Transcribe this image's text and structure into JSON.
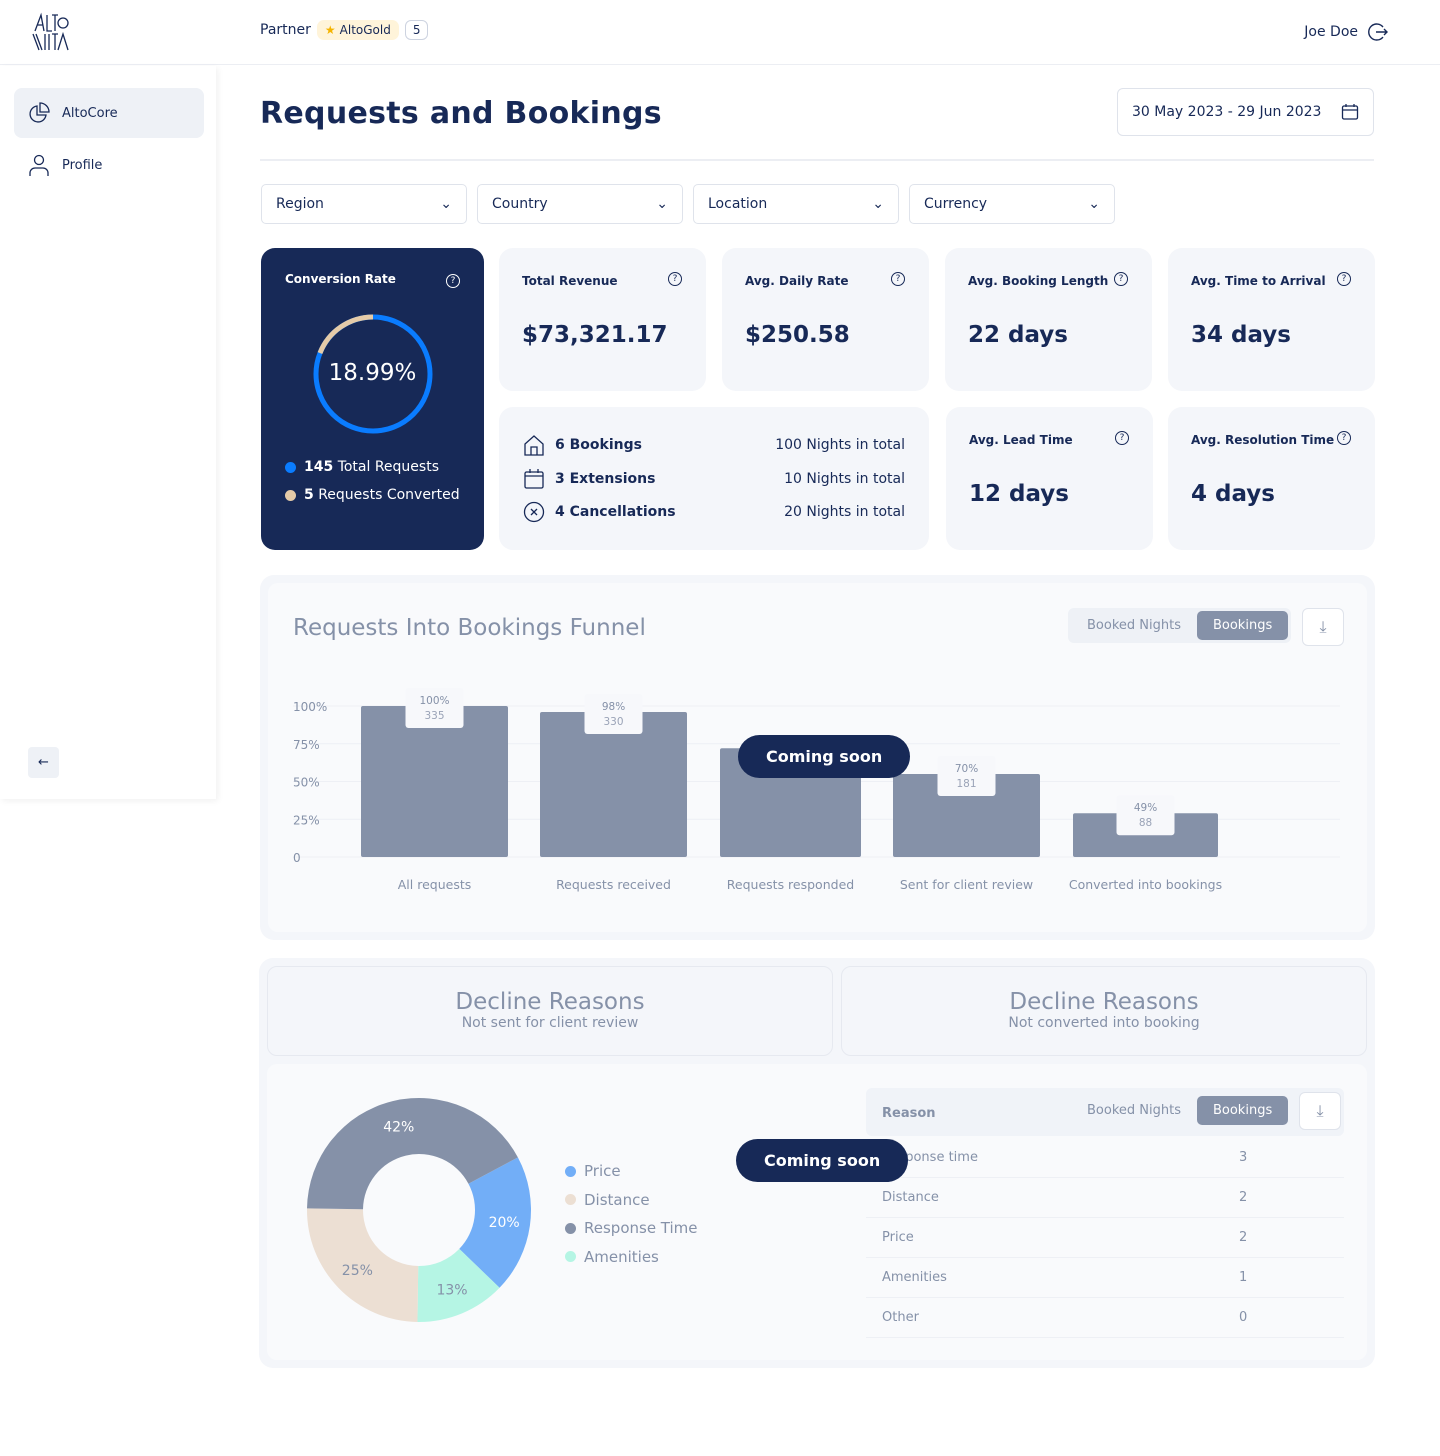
{
  "header": {
    "partner_label": "Partner",
    "tier": "AltoGold",
    "tier_count": "5",
    "user": "Joe Doe"
  },
  "sidebar": {
    "items": [
      {
        "label": "AltoCore",
        "icon": "pie-chart-icon",
        "active": true
      },
      {
        "label": "Profile",
        "icon": "user-icon"
      }
    ]
  },
  "page": {
    "title": "Requests and Bookings",
    "date_range": "30 May 2023 - 29 Jun 2023"
  },
  "filters": [
    "Region",
    "Country",
    "Location",
    "Currency"
  ],
  "conversion": {
    "label": "Conversion Rate",
    "value": "18.99%",
    "rate": 18.99,
    "total": "145",
    "total_label": "Total Requests",
    "converted": "5",
    "converted_label": "Requests Converted",
    "colors": {
      "total": "#0a7cff",
      "converted": "#e5cba8"
    }
  },
  "kpis": [
    {
      "label": "Total Revenue",
      "value": "$73,321.17"
    },
    {
      "label": "Avg. Daily Rate",
      "value": "$250.58"
    },
    {
      "label": "Avg. Booking Length",
      "value": "22 days"
    },
    {
      "label": "Avg. Time to Arrival",
      "value": "34 days"
    },
    {
      "label": "Avg. Lead Time",
      "value": "12 days"
    },
    {
      "label": "Avg. Resolution Time",
      "value": "4 days"
    }
  ],
  "bookings": [
    {
      "icon": "house-icon",
      "label": "6 Bookings",
      "nights": "100 Nights in total"
    },
    {
      "icon": "calendar-icon",
      "label": "3 Extensions",
      "nights": "10 Nights in total"
    },
    {
      "icon": "x-circle-icon",
      "label": "4 Cancellations",
      "nights": "20 Nights in total"
    }
  ],
  "funnel": {
    "title": "Requests Into Bookings Funnel",
    "toggle": [
      "Booked Nights",
      "Bookings"
    ],
    "active": "Bookings",
    "coming_soon": "Coming soon"
  },
  "chart_data": [
    {
      "type": "bar",
      "yticks": [
        "100%",
        "75%",
        "50%",
        "25%",
        "0"
      ],
      "ylim": [
        0,
        100
      ],
      "categories": [
        "All requests",
        "Requests received",
        "Requests responded",
        "Sent for client review",
        "Converted into bookings"
      ],
      "pct_labels": [
        "100%",
        "98%",
        "",
        "70%",
        "49%"
      ],
      "counts": [
        "335",
        "330",
        "",
        "181",
        "88"
      ],
      "bar_levels": [
        100,
        96,
        72,
        55,
        29
      ],
      "color": "#8591a8"
    },
    {
      "type": "pie",
      "labels": [
        "Price",
        "Distance",
        "Response Time",
        "Amenities"
      ],
      "values": [
        20,
        25,
        42,
        13
      ],
      "colors": [
        "#72aef7",
        "#ecdfd3",
        "#8591a8",
        "#b5f5e4"
      ]
    }
  ],
  "decline": {
    "left": {
      "title": "Decline Reasons",
      "subtitle": "Not sent for client review"
    },
    "right": {
      "title": "Decline Reasons",
      "subtitle": "Not converted into booking"
    },
    "coming_soon": "Coming soon",
    "table_header": "Reason",
    "toggle": [
      "Booked Nights",
      "Bookings"
    ],
    "rows": [
      {
        "reason": "Response time",
        "value": "3"
      },
      {
        "reason": "Distance",
        "value": "2"
      },
      {
        "reason": "Price",
        "value": "2"
      },
      {
        "reason": "Amenities",
        "value": "1"
      },
      {
        "reason": "Other",
        "value": "0"
      }
    ]
  }
}
